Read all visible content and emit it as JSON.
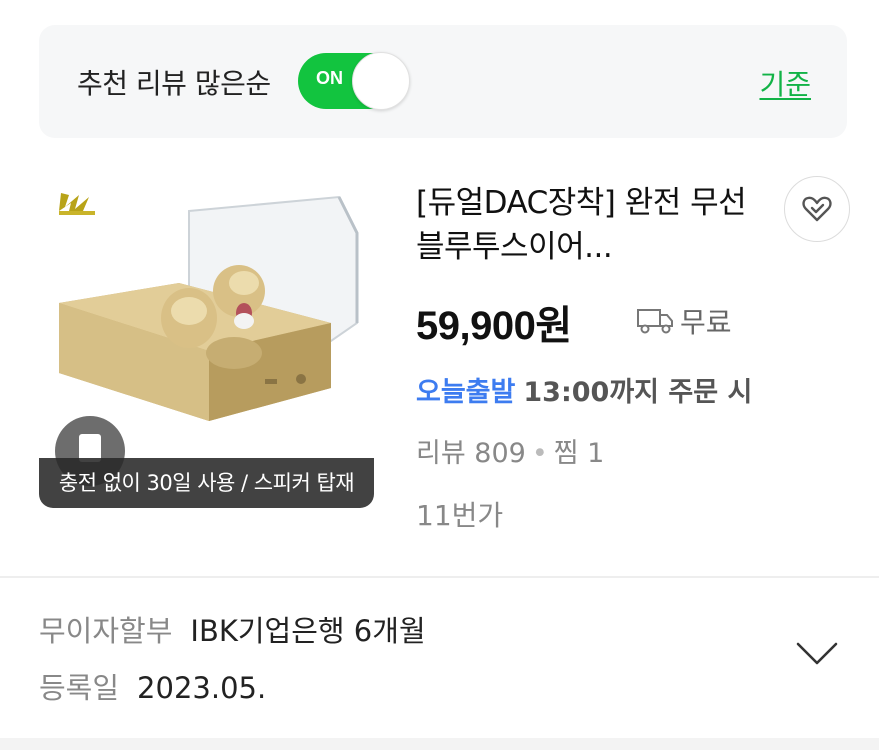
{
  "filter": {
    "label": "추천 리뷰 많은순",
    "toggle_text": "ON",
    "toggle_on": true,
    "criteria_link": "기준"
  },
  "product": {
    "badge": "충전 없이 30일 사용 / 스피커 탑재",
    "title": "[듀얼DAC장착] 완전 무선 블루투스이어...",
    "price": "59,900원",
    "shipping": "무료",
    "delivery_tag": "오늘출발",
    "delivery_time": "13:00까지 주문 시",
    "review_label": "리뷰 809",
    "wish_label": "찜 1",
    "separator": "•",
    "seller": "11번가"
  },
  "details": {
    "installment_key": "무이자할부",
    "installment_value": "IBK기업은행 6개월",
    "registered_key": "등록일",
    "registered_value": "2023.05."
  },
  "icons": {
    "wish": "heart-check-icon",
    "shipping": "truck-icon",
    "expand": "chevron-down-icon"
  },
  "colors": {
    "toggle_on": "#12c43f",
    "criteria_link": "#12b347",
    "delivery_tag": "#3d7cf0"
  }
}
